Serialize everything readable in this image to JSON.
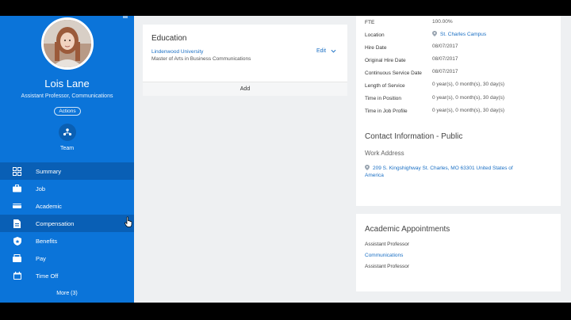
{
  "profile": {
    "name": "Lois Lane",
    "title": "Assistant Professor, Communications",
    "actions_label": "Actions",
    "team_label": "Team"
  },
  "nav": {
    "items": [
      {
        "label": "Summary",
        "icon": "summary-icon"
      },
      {
        "label": "Job",
        "icon": "job-icon"
      },
      {
        "label": "Academic",
        "icon": "academic-icon"
      },
      {
        "label": "Compensation",
        "icon": "compensation-icon"
      },
      {
        "label": "Benefits",
        "icon": "benefits-icon"
      },
      {
        "label": "Pay",
        "icon": "pay-icon"
      },
      {
        "label": "Time Off",
        "icon": "time-off-icon"
      }
    ],
    "selected": "Compensation",
    "more_label": "More (3)"
  },
  "education": {
    "title": "Education",
    "school": "Lindenwood University",
    "degree": "Master of Arts in Business Communications",
    "edit_label": "Edit",
    "add_label": "Add"
  },
  "job_details": {
    "rows": [
      {
        "label": "FTE",
        "value": "100.00%"
      },
      {
        "label": "Location",
        "value": "St. Charles Campus"
      },
      {
        "label": "Hire Date",
        "value": "08/07/2017"
      },
      {
        "label": "Original Hire Date",
        "value": "08/07/2017"
      },
      {
        "label": "Continuous Service Date",
        "value": "08/07/2017"
      },
      {
        "label": "Length of Service",
        "value": "0 year(s), 0 month(s), 30 day(s)"
      },
      {
        "label": "Time in Position",
        "value": "0 year(s), 0 month(s), 30 day(s)"
      },
      {
        "label": "Time in Job Profile",
        "value": "0 year(s), 0 month(s), 30 day(s)"
      }
    ]
  },
  "contact": {
    "title": "Contact Information - Public",
    "work_address_label": "Work Address",
    "work_address": "209 S. Kingshighway St. Charles, MO 63301 United States of America"
  },
  "academic_appointments": {
    "title": "Academic Appointments",
    "lines": [
      "Assistant Professor",
      "Communications",
      "Assistant Professor"
    ]
  },
  "colors": {
    "sidebar": "#0b74d9",
    "sidebar_selected": "#095fb5",
    "link": "#1a6fc4",
    "background": "#eef0f2"
  }
}
